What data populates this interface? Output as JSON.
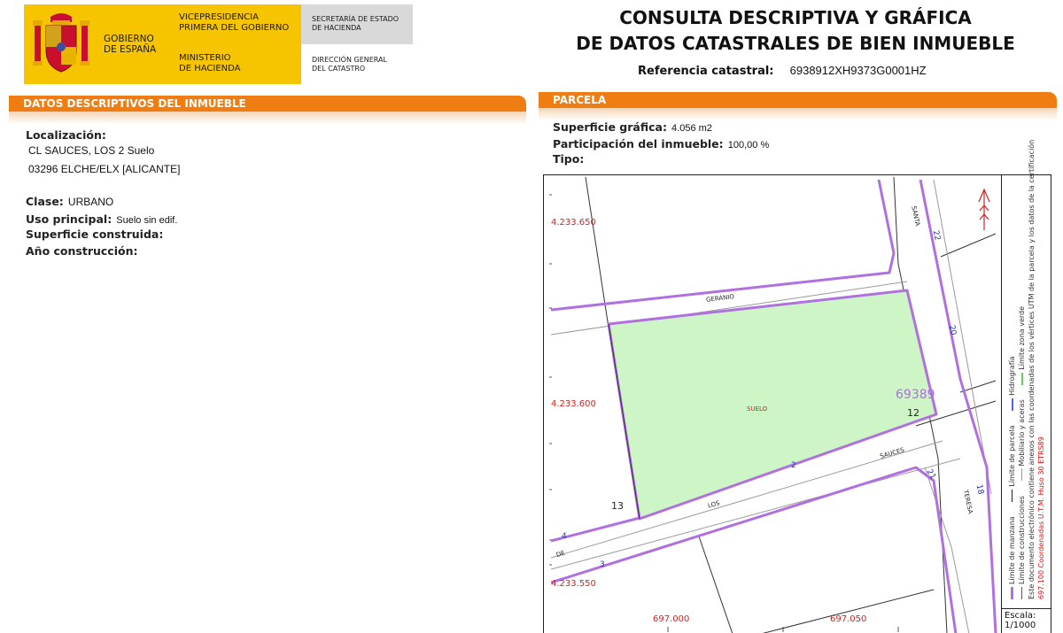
{
  "header": {
    "gov_lines": [
      "GOBIERNO",
      "DE ESPAÑA"
    ],
    "vice_lines": [
      "VICEPRESIDENCIA",
      "PRIMERA DEL GOBIERNO"
    ],
    "ministry_lines": [
      "MINISTERIO",
      "DE HACIENDA"
    ],
    "secretaria_lines": [
      "SECRETARÍA DE ESTADO",
      "DE HACIENDA"
    ],
    "direccion_lines": [
      "DIRECCIÓN GENERAL",
      "DEL CATASTRO"
    ],
    "title_lines": [
      "CONSULTA DESCRIPTIVA Y GRÁFICA",
      "DE DATOS CATASTRALES DE BIEN INMUEBLE"
    ],
    "ref_label": "Referencia catastral:",
    "ref_value": "6938912XH9373G0001HZ"
  },
  "left": {
    "section_title": "DATOS DESCRIPTIVOS DEL INMUEBLE",
    "localizacion_label": "Localización:",
    "localizacion_lines": [
      "CL SAUCES, LOS 2 Suelo",
      "03296 ELCHE/ELX [ALICANTE]"
    ],
    "clase_label": "Clase:",
    "clase_value": "URBANO",
    "uso_label": "Uso principal:",
    "uso_value": "Suelo sin edif.",
    "superficie_label": "Superficie construida:",
    "ano_label": "Año construcción:"
  },
  "right": {
    "section_title": "PARCELA",
    "superficie_label": "Superficie gráfica:",
    "superficie_value": "4.056 m2",
    "participacion_label": "Participación del inmueble:",
    "participacion_value": "100,00 %",
    "tipo_label": "Tipo:"
  },
  "map": {
    "y_coords": [
      "4.233.650",
      "4.233.600",
      "4.233.550"
    ],
    "x_coords": [
      "697.000",
      "697.050"
    ],
    "parcel_id": "69389",
    "parcel_number": "12",
    "parcel_label": "SUELO",
    "street_labels": [
      "GERANIO",
      "SANTA",
      "TERESA",
      "SAUCES",
      "LOS",
      "DE"
    ],
    "house_numbers": [
      "22",
      "20",
      "18",
      "21",
      "2",
      "4",
      "3"
    ],
    "neighbor_number": "13",
    "colors": {
      "parcel_fill": "#cdf5c6",
      "parcel_line": "#b070e0",
      "coord_red": "#d22222",
      "number_blue": "#2233bb"
    }
  },
  "legend": {
    "items_1": [
      "Límite de manzana",
      "Límite de parcela",
      "Hidrografía"
    ],
    "items_2": [
      "Límite de construcciones",
      "Mobiliario y aceras",
      "Límite zona verde"
    ],
    "note": "Este documento electrónico contiene anexos con las coordenadas de los vértices UTM de la parcela y los datos de la certificación",
    "coords_note": "697.100 Coordenadas U.T.M. Huso 30 ETRS89",
    "scale_label": "Escala:",
    "scale_value": "1/1000"
  }
}
